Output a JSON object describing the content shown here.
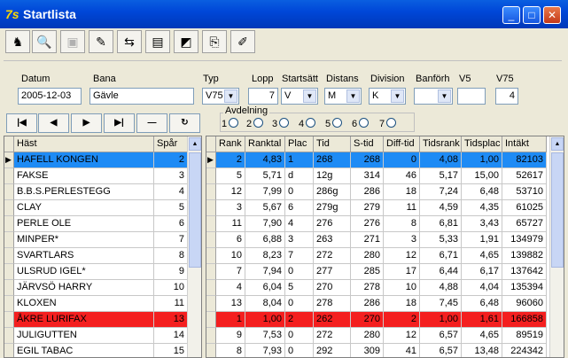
{
  "window": {
    "title": "Startlista",
    "app_icon": "7s"
  },
  "toolbar": {
    "buttons": [
      {
        "name": "horse-icon",
        "glyph": "♞"
      },
      {
        "name": "binoculars-icon",
        "glyph": "🔍"
      },
      {
        "name": "save-icon",
        "glyph": "▣"
      },
      {
        "name": "brush-icon",
        "glyph": "✎"
      },
      {
        "name": "transfer-icon",
        "glyph": "⇆"
      },
      {
        "name": "print-icon",
        "glyph": "▤"
      },
      {
        "name": "map-icon",
        "glyph": "◩"
      },
      {
        "name": "copy-icon",
        "glyph": "⎘"
      },
      {
        "name": "edit-icon",
        "glyph": "✐"
      }
    ]
  },
  "form": {
    "datum_label": "Datum",
    "datum_value": "2005-12-03",
    "bana_label": "Bana",
    "bana_value": "Gävle",
    "typ_label": "Typ",
    "typ_value": "V75",
    "lopp_label": "Lopp",
    "lopp_value": "7",
    "startsatt_label": "Startsätt",
    "startsatt_value": "V",
    "distans_label": "Distans",
    "distans_value": "M",
    "division_label": "Division",
    "division_value": "K",
    "banforh_label": "Banförh",
    "banforh_value": "",
    "v5_label": "V5",
    "v5_value": "",
    "v75_label": "V75",
    "v75_value": "4"
  },
  "nav": {
    "first": "|◀",
    "prev": "◀",
    "next": "▶",
    "last": "▶|",
    "delete": "—",
    "refresh": "↻"
  },
  "avdelning": {
    "label": "Avdelning",
    "options": [
      "1",
      "2",
      "3",
      "4",
      "5",
      "6",
      "7"
    ]
  },
  "left_grid": {
    "headers": [
      "Häst",
      "Spår"
    ],
    "rows": [
      [
        "HAFELL KONGEN",
        "2"
      ],
      [
        "FAKSE",
        "3"
      ],
      [
        "B.B.S.PERLESTEGG",
        "4"
      ],
      [
        "CLAY",
        "5"
      ],
      [
        "PERLE OLE",
        "6"
      ],
      [
        "MINPER*",
        "7"
      ],
      [
        "SVARTLARS",
        "8"
      ],
      [
        "ULSRUD IGEL*",
        "9"
      ],
      [
        "JÄRVSÖ HARRY",
        "10"
      ],
      [
        "KLOXEN",
        "11"
      ],
      [
        "ÅKRE LURIFAX",
        "13"
      ],
      [
        "JULIGUTTEN",
        "14"
      ],
      [
        "EGIL TABAC",
        "15"
      ]
    ]
  },
  "right_grid": {
    "headers": [
      "Rank",
      "Ranktal",
      "Plac",
      "Tid",
      "S-tid",
      "Diff-tid",
      "Tidsrank",
      "Tidsplac",
      "Intäkt"
    ],
    "rows": [
      [
        "2",
        "4,83",
        "1",
        "268",
        "268",
        "0",
        "4,08",
        "1,00",
        "82103"
      ],
      [
        "5",
        "5,71",
        "d",
        "12g",
        "314",
        "46",
        "5,17",
        "15,00",
        "52617"
      ],
      [
        "12",
        "7,99",
        "0",
        "286g",
        "286",
        "18",
        "7,24",
        "6,48",
        "53710"
      ],
      [
        "3",
        "5,67",
        "6",
        "279g",
        "279",
        "11",
        "4,59",
        "4,35",
        "61025"
      ],
      [
        "11",
        "7,90",
        "4",
        "276",
        "276",
        "8",
        "6,81",
        "3,43",
        "65727"
      ],
      [
        "6",
        "6,88",
        "3",
        "263",
        "271",
        "3",
        "5,33",
        "1,91",
        "134979"
      ],
      [
        "10",
        "8,23",
        "7",
        "272",
        "280",
        "12",
        "6,71",
        "4,65",
        "139882"
      ],
      [
        "7",
        "7,94",
        "0",
        "277",
        "285",
        "17",
        "6,44",
        "6,17",
        "137642"
      ],
      [
        "4",
        "6,04",
        "5",
        "270",
        "278",
        "10",
        "4,88",
        "4,04",
        "135394"
      ],
      [
        "13",
        "8,04",
        "0",
        "278",
        "286",
        "18",
        "7,45",
        "6,48",
        "96060"
      ],
      [
        "1",
        "1,00",
        "2",
        "262",
        "270",
        "2",
        "1,00",
        "1,61",
        "166858"
      ],
      [
        "9",
        "7,53",
        "0",
        "272",
        "280",
        "12",
        "6,57",
        "4,65",
        "89519"
      ],
      [
        "8",
        "7,93",
        "0",
        "292",
        "309",
        "41",
        "6,57",
        "13,48",
        "224342"
      ]
    ]
  },
  "colors": {
    "selected_blue": "#1e8bf5",
    "selected_red": "#f41f1f"
  }
}
